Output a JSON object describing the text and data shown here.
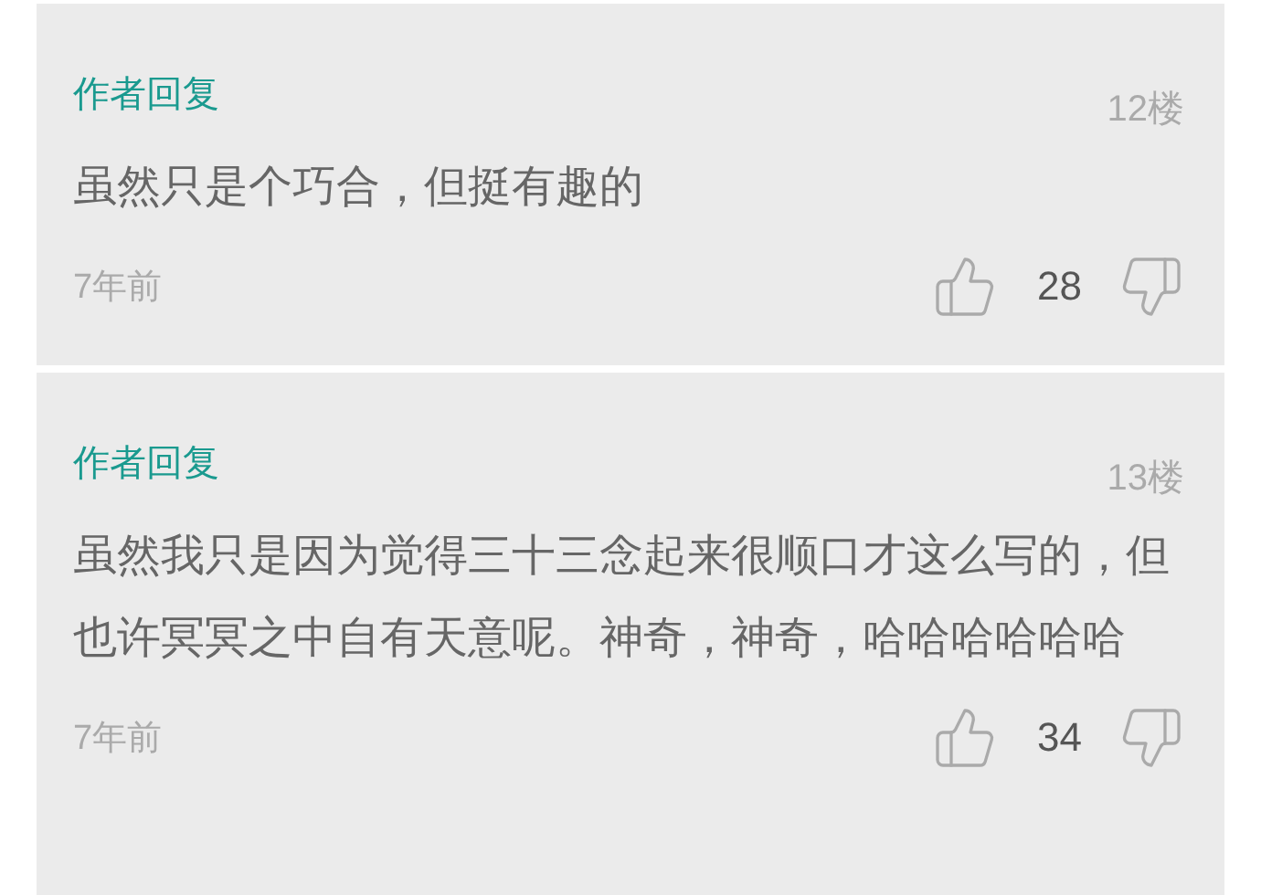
{
  "comments": [
    {
      "author_label": "作者回复",
      "floor": "12楼",
      "text": "虽然只是个巧合，但挺有趣的",
      "time": "7年前",
      "likes": "28"
    },
    {
      "author_label": "作者回复",
      "floor": "13楼",
      "text": "虽然我只是因为觉得三十三念起来很顺口才这么写的，但也许冥冥之中自有天意呢。神奇，神奇，哈哈哈哈哈哈",
      "time": "7年前",
      "likes": "34"
    }
  ]
}
